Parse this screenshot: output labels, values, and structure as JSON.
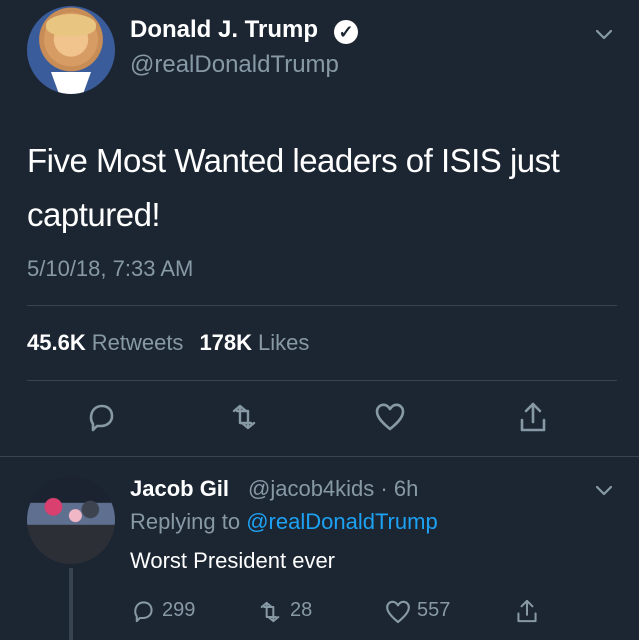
{
  "tweet": {
    "author_name": "Donald J. Trump",
    "author_handle": "@realDonaldTrump",
    "verified": true,
    "text_line_1": "Five Most Wanted leaders of ISIS just",
    "text_line_2": "captured!",
    "timestamp": "5/10/18, 7:33 AM",
    "retweets_count": "45.6K",
    "retweets_label": "Retweets",
    "likes_count": "178K",
    "likes_label": "Likes",
    "icons": {
      "reply": "reply-icon",
      "retweet": "retweet-icon",
      "like": "heart-icon",
      "share": "share-icon",
      "menu": "chevron-down-icon"
    }
  },
  "reply": {
    "author_name": "Jacob Gil",
    "author_handle": "@jacob4kids",
    "separator": "·",
    "time": "6h",
    "replying_prefix": "Replying to",
    "replying_to": "@realDonaldTrump",
    "text": "Worst President ever",
    "reply_count": "299",
    "retweet_count": "28",
    "like_count": "557",
    "icons": {
      "reply": "reply-icon",
      "retweet": "retweet-icon",
      "like": "heart-icon",
      "share": "share-icon",
      "menu": "chevron-down-icon"
    }
  },
  "colors": {
    "background": "#1c2633",
    "primary_text": "#ffffff",
    "secondary_text": "#8899a6",
    "divider": "#38444d",
    "link": "#1da1f2"
  }
}
